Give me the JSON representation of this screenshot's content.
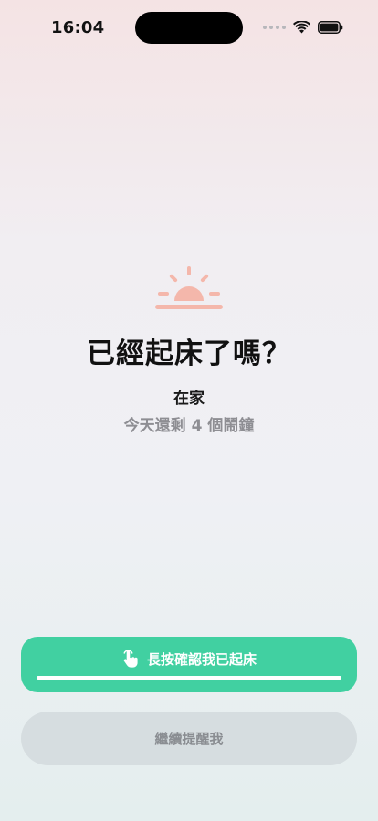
{
  "status_bar": {
    "time": "16:04",
    "icons": [
      "signal-dots-icon",
      "wifi-icon",
      "battery-icon"
    ]
  },
  "alarm": {
    "icon": "sunrise-icon",
    "icon_color": "#f4b7ab",
    "title": "已經起床了嗎？",
    "location": "在家",
    "remaining": "今天還剩 4 個鬧鐘"
  },
  "actions": {
    "confirm_label": "長按確認我已起床",
    "confirm_icon": "hand-tap-icon",
    "confirm_color": "#41d0a1",
    "hold_progress": 1.0,
    "snooze_label": "繼續提醒我"
  }
}
